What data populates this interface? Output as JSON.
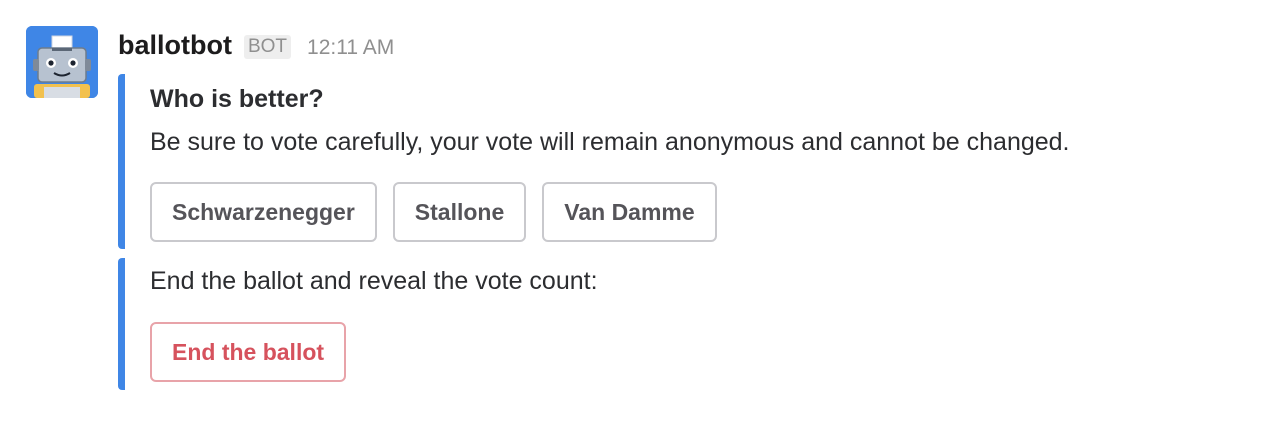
{
  "message": {
    "sender": "ballotbot",
    "badge": "BOT",
    "timestamp": "12:11 AM",
    "avatar_icon": "ballot-robot-icon"
  },
  "ballot": {
    "title": "Who is better?",
    "text": "Be sure to vote carefully, your vote will remain anonymous and cannot be changed.",
    "accent_color": "#3f86e6",
    "options": [
      {
        "label": "Schwarzenegger"
      },
      {
        "label": "Stallone"
      },
      {
        "label": "Van Damme"
      }
    ]
  },
  "end": {
    "text": "End the ballot and reveal the vote count:",
    "button_label": "End the ballot",
    "button_color": "#d6525d"
  }
}
